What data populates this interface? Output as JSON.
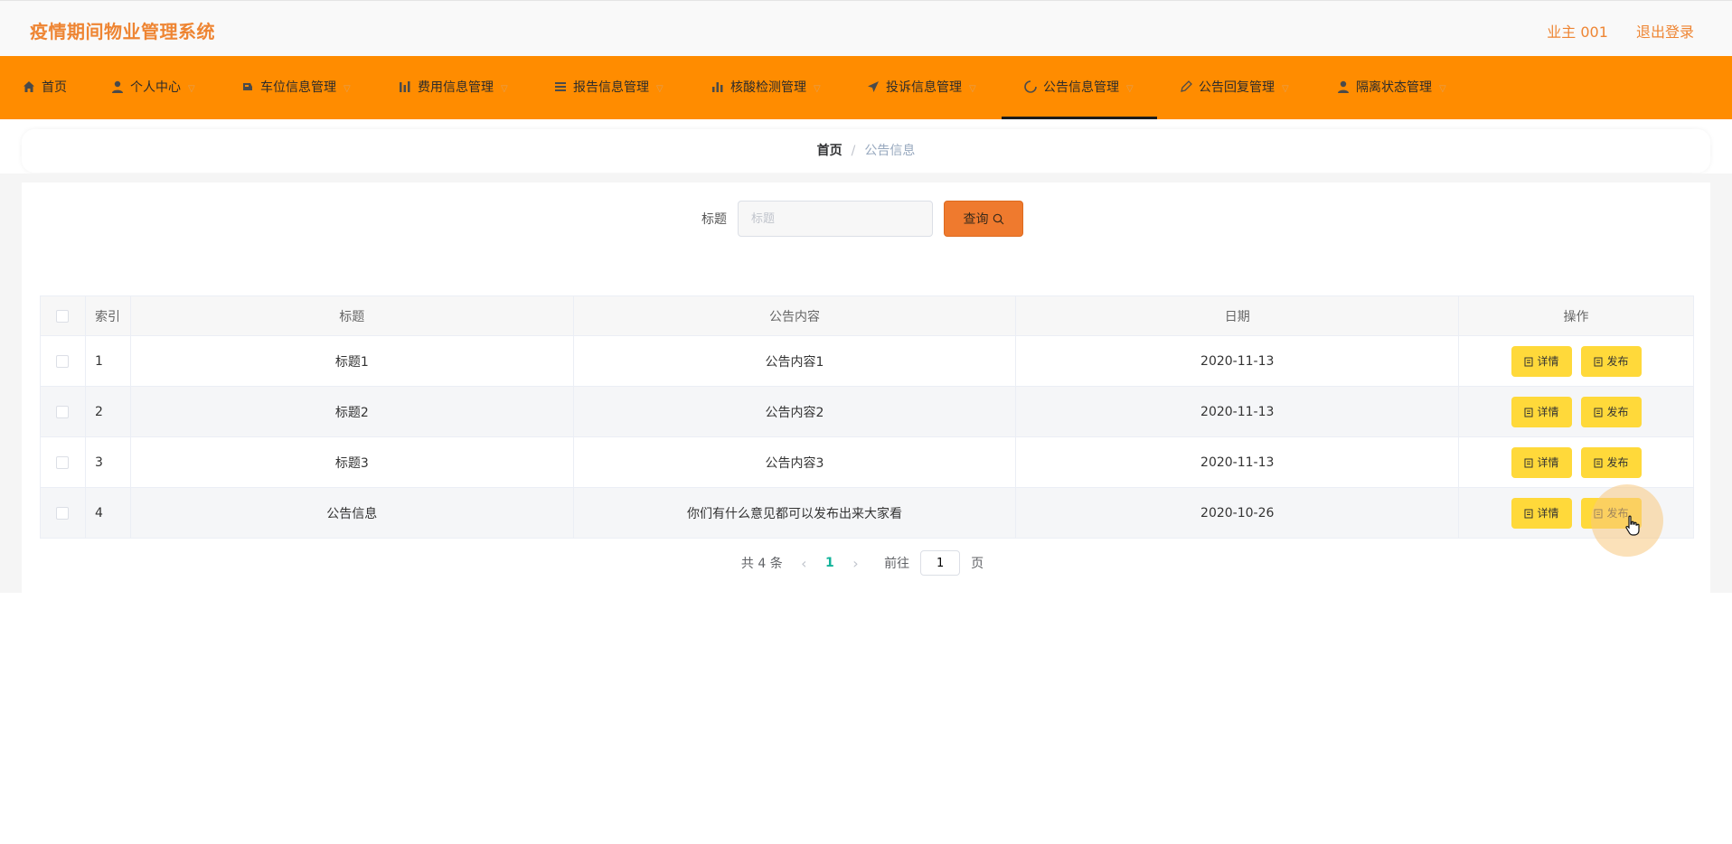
{
  "app": {
    "title": "疫情期间物业管理系统",
    "user": "业主 001",
    "logout": "退出登录"
  },
  "nav": {
    "items": [
      {
        "label": "首页",
        "icon": "home-icon"
      },
      {
        "label": "个人中心",
        "icon": "user-icon"
      },
      {
        "label": "车位信息管理",
        "icon": "car-icon"
      },
      {
        "label": "费用信息管理",
        "icon": "bar-chart-icon"
      },
      {
        "label": "报告信息管理",
        "icon": "list-icon"
      },
      {
        "label": "核酸检测管理",
        "icon": "stats-icon"
      },
      {
        "label": "投诉信息管理",
        "icon": "send-icon"
      },
      {
        "label": "公告信息管理",
        "icon": "loading-icon"
      },
      {
        "label": "公告回复管理",
        "icon": "edit-icon"
      },
      {
        "label": "隔离状态管理",
        "icon": "person-icon"
      }
    ],
    "active_index": 7,
    "colors": {
      "bar": "#ff8c00",
      "title": "#ee8533"
    }
  },
  "breadcrumb": {
    "home": "首页",
    "separator": "/",
    "current": "公告信息"
  },
  "search": {
    "label": "标题",
    "placeholder": "标题",
    "button_label": "查询"
  },
  "table": {
    "headers": {
      "index": "索引",
      "title": "标题",
      "content": "公告内容",
      "date": "日期",
      "actions": "操作"
    },
    "rows": [
      {
        "index": "1",
        "title": "标题1",
        "content": "公告内容1",
        "date": "2020-11-13"
      },
      {
        "index": "2",
        "title": "标题2",
        "content": "公告内容2",
        "date": "2020-11-13"
      },
      {
        "index": "3",
        "title": "标题3",
        "content": "公告内容3",
        "date": "2020-11-13"
      },
      {
        "index": "4",
        "title": "公告信息",
        "content": "你们有什么意见都可以发布出来大家看",
        "date": "2020-10-26"
      }
    ],
    "action_labels": {
      "detail": "详情",
      "publish": "发布"
    }
  },
  "pagination": {
    "total_text": "共 4 条",
    "current_page": "1",
    "goto_label": "前往",
    "goto_value": "1",
    "page_suffix": "页"
  }
}
